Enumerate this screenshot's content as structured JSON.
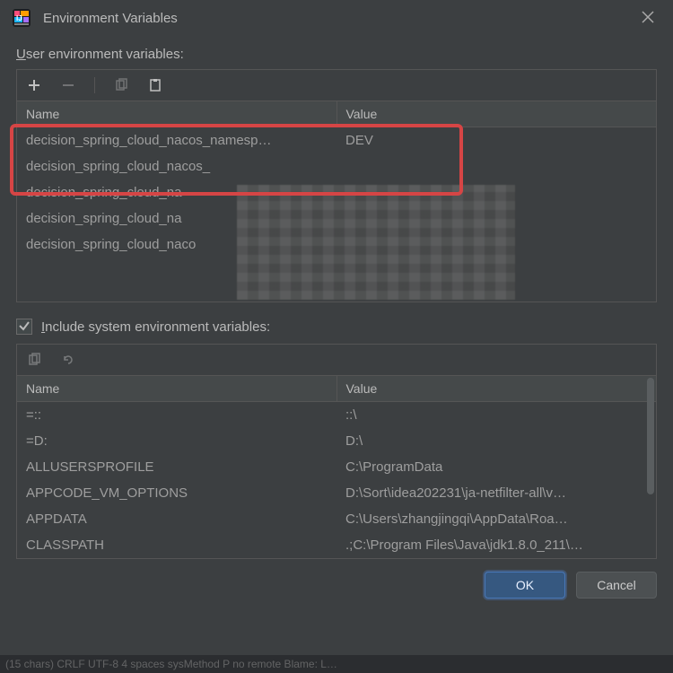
{
  "window": {
    "title": "Environment Variables"
  },
  "userVars": {
    "label_pre": "U",
    "label_post": "ser environment variables:",
    "cols": {
      "name": "Name",
      "value": "Value"
    },
    "rows": [
      {
        "name": "decision_spring_cloud_nacos_namesp…",
        "value": "DEV"
      },
      {
        "name": "decision_spring_cloud_nacos_",
        "value": ""
      },
      {
        "name": "decision_spring_cloud_na",
        "value": ""
      },
      {
        "name": "decision_spring_cloud_na",
        "value": ""
      },
      {
        "name": "decision_spring_cloud_naco",
        "value": ""
      }
    ]
  },
  "includeSystem": {
    "checked": true,
    "label_pre": "I",
    "label_post": "nclude system environment variables:"
  },
  "sysVars": {
    "cols": {
      "name": "Name",
      "value": "Value"
    },
    "rows": [
      {
        "name": "=::",
        "value": "::\\"
      },
      {
        "name": "=D:",
        "value": "D:\\"
      },
      {
        "name": "ALLUSERSPROFILE",
        "value": "C:\\ProgramData"
      },
      {
        "name": "APPCODE_VM_OPTIONS",
        "value": "D:\\Sort\\idea202231\\ja-netfilter-all\\v…"
      },
      {
        "name": "APPDATA",
        "value": "C:\\Users\\zhangjingqi\\AppData\\Roa…"
      },
      {
        "name": "CLASSPATH",
        "value": ".;C:\\Program Files\\Java\\jdk1.8.0_211\\…"
      }
    ]
  },
  "buttons": {
    "ok": "OK",
    "cancel": "Cancel"
  },
  "statusbar": "(15 chars)   CRLF   UTF-8   4 spaces   sysMethod   P  no remote   Blame: L…"
}
